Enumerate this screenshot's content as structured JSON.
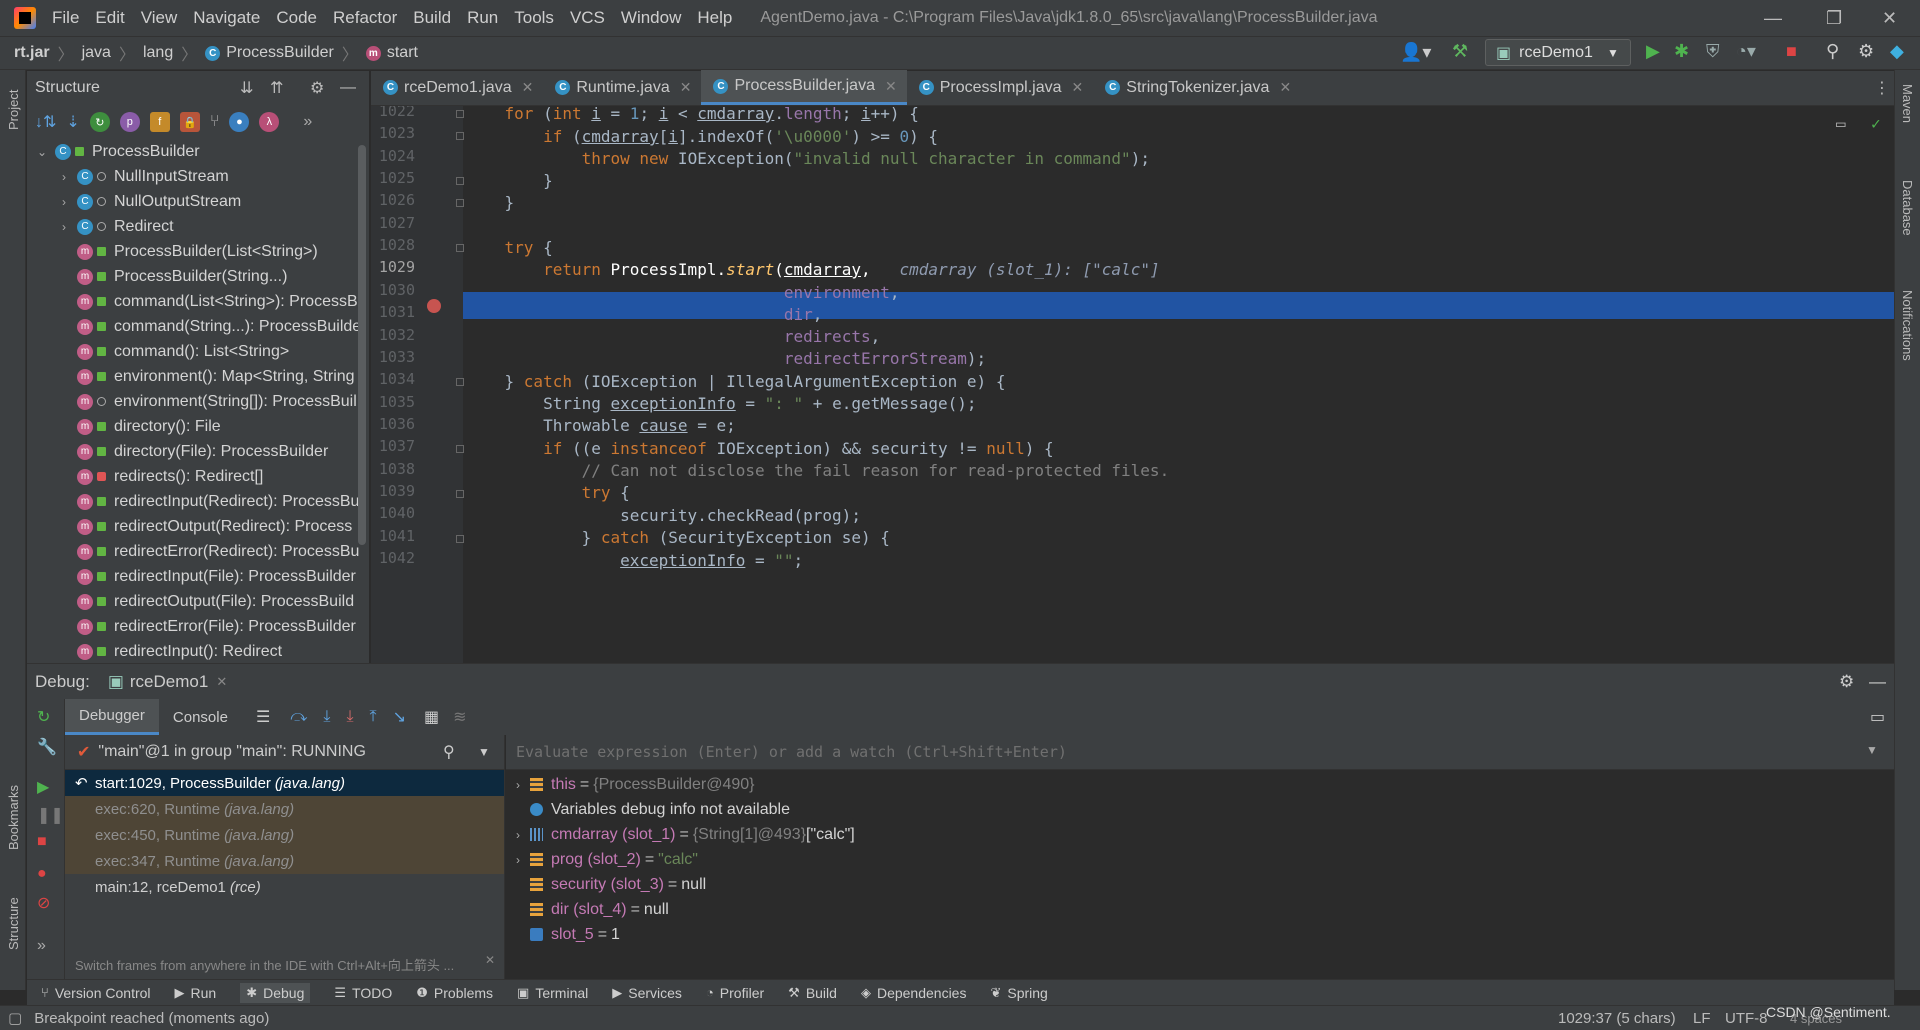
{
  "menubar": {
    "items": [
      "File",
      "Edit",
      "View",
      "Navigate",
      "Code",
      "Refactor",
      "Build",
      "Run",
      "Tools",
      "VCS",
      "Window",
      "Help"
    ],
    "window_title": "AgentDemo.java - C:\\Program Files\\Java\\jdk1.8.0_65\\src\\java\\lang\\ProcessBuilder.java"
  },
  "navbar": {
    "crumbs": [
      "rt.jar",
      "java",
      "lang",
      "ProcessBuilder",
      "start"
    ],
    "run_config": "rceDemo1"
  },
  "left_strip": {
    "project": "Project",
    "bookmarks": "Bookmarks",
    "structure": "Structure"
  },
  "right_strip": {
    "maven": "Maven",
    "database": "Database",
    "notifications": "Notifications"
  },
  "structure": {
    "title": "Structure",
    "tree": [
      {
        "label": "ProcessBuilder",
        "kind": "class",
        "level": 0,
        "arrow": "v"
      },
      {
        "label": "NullInputStream",
        "kind": "class",
        "level": 1,
        "arrow": ">"
      },
      {
        "label": "NullOutputStream",
        "kind": "class",
        "level": 1,
        "arrow": ">"
      },
      {
        "label": "Redirect",
        "kind": "class",
        "level": 1,
        "arrow": ">"
      },
      {
        "label": "ProcessBuilder(List<String>)",
        "kind": "method",
        "level": 1,
        "vis": "pub"
      },
      {
        "label": "ProcessBuilder(String...)",
        "kind": "method",
        "level": 1,
        "vis": "pub"
      },
      {
        "label": "command(List<String>): ProcessB",
        "kind": "method",
        "level": 1,
        "vis": "pub"
      },
      {
        "label": "command(String...): ProcessBuilde",
        "kind": "method",
        "level": 1,
        "vis": "pub"
      },
      {
        "label": "command(): List<String>",
        "kind": "method",
        "level": 1,
        "vis": "pub"
      },
      {
        "label": "environment(): Map<String, String",
        "kind": "method",
        "level": 1,
        "vis": "pub"
      },
      {
        "label": "environment(String[]): ProcessBuil",
        "kind": "method",
        "level": 1,
        "vis": "pkg"
      },
      {
        "label": "directory(): File",
        "kind": "method",
        "level": 1,
        "vis": "pub"
      },
      {
        "label": "directory(File): ProcessBuilder",
        "kind": "method",
        "level": 1,
        "vis": "pub"
      },
      {
        "label": "redirects(): Redirect[]",
        "kind": "method",
        "level": 1,
        "vis": "priv"
      },
      {
        "label": "redirectInput(Redirect): ProcessBu",
        "kind": "method",
        "level": 1,
        "vis": "pub"
      },
      {
        "label": "redirectOutput(Redirect): Process",
        "kind": "method",
        "level": 1,
        "vis": "pub"
      },
      {
        "label": "redirectError(Redirect): ProcessBu",
        "kind": "method",
        "level": 1,
        "vis": "pub"
      },
      {
        "label": "redirectInput(File): ProcessBuilder",
        "kind": "method",
        "level": 1,
        "vis": "pub"
      },
      {
        "label": "redirectOutput(File): ProcessBuild",
        "kind": "method",
        "level": 1,
        "vis": "pub"
      },
      {
        "label": "redirectError(File): ProcessBuilder",
        "kind": "method",
        "level": 1,
        "vis": "pub"
      },
      {
        "label": "redirectInput(): Redirect",
        "kind": "method",
        "level": 1,
        "vis": "pub"
      }
    ]
  },
  "tabs": [
    {
      "label": "rceDemo1.java",
      "active": false
    },
    {
      "label": "Runtime.java",
      "active": false
    },
    {
      "label": "ProcessBuilder.java",
      "active": true
    },
    {
      "label": "ProcessImpl.java",
      "active": false
    },
    {
      "label": "StringTokenizer.java",
      "active": false
    }
  ],
  "editor": {
    "line_numbers": [
      "1022",
      "1023",
      "1024",
      "1025",
      "1026",
      "1027",
      "1028",
      "1029",
      "1030",
      "1031",
      "1032",
      "1033",
      "1034",
      "1035",
      "1036",
      "1037",
      "1038",
      "1039",
      "1040",
      "1041",
      "1042"
    ],
    "exec_line": "1029",
    "inlay_hint": "cmdarray (slot_1): [\"calc\"]"
  },
  "debug": {
    "label": "Debug:",
    "session": "rceDemo1",
    "tabs": [
      "Debugger",
      "Console"
    ],
    "thread": "\"main\"@1 in group \"main\": RUNNING",
    "frames": [
      {
        "method": "start:1029, ProcessBuilder",
        "pkg": "(java.lang)",
        "state": "sel"
      },
      {
        "method": "exec:620, Runtime",
        "pkg": "(java.lang)",
        "state": "dim"
      },
      {
        "method": "exec:450, Runtime",
        "pkg": "(java.lang)",
        "state": "dim"
      },
      {
        "method": "exec:347, Runtime",
        "pkg": "(java.lang)",
        "state": "dim"
      },
      {
        "method": "main:12, rceDemo1",
        "pkg": "(rce)",
        "state": "normal"
      }
    ],
    "frames_hint": "Switch frames from anywhere in the IDE with Ctrl+Alt+向上箭头 ...",
    "eval_placeholder": "Evaluate expression (Enter) or add a watch (Ctrl+Shift+Enter)",
    "variables": [
      {
        "arrow": ">",
        "icon": "field",
        "name": "this",
        "type": "{ProcessBuilder@490}",
        "value": ""
      },
      {
        "arrow": "",
        "icon": "info",
        "name": "Variables debug info not available",
        "type": "",
        "value": ""
      },
      {
        "arrow": ">",
        "icon": "arr",
        "name": "cmdarray (slot_1)",
        "type": "{String[1]@493}",
        "value": "[\"calc\"]"
      },
      {
        "arrow": ">",
        "icon": "field",
        "name": "prog (slot_2)",
        "type": "",
        "value": "\"calc\""
      },
      {
        "arrow": "",
        "icon": "field",
        "name": "security (slot_3)",
        "type": "",
        "value": "null"
      },
      {
        "arrow": "",
        "icon": "field",
        "name": "dir (slot_4)",
        "type": "",
        "value": "null"
      },
      {
        "arrow": "",
        "icon": "prim",
        "name": "slot_5",
        "type": "",
        "value": "1"
      }
    ]
  },
  "bottom_tools": [
    "Version Control",
    "Run",
    "Debug",
    "TODO",
    "Problems",
    "Terminal",
    "Services",
    "Profiler",
    "Build",
    "Dependencies",
    "Spring"
  ],
  "status": {
    "message": "Breakpoint reached (moments ago)",
    "position": "1029:37 (5 chars)",
    "line_sep": "LF",
    "encoding": "UTF-8",
    "indent": "4 spaces",
    "watermark": "CSDN @Sentiment."
  }
}
